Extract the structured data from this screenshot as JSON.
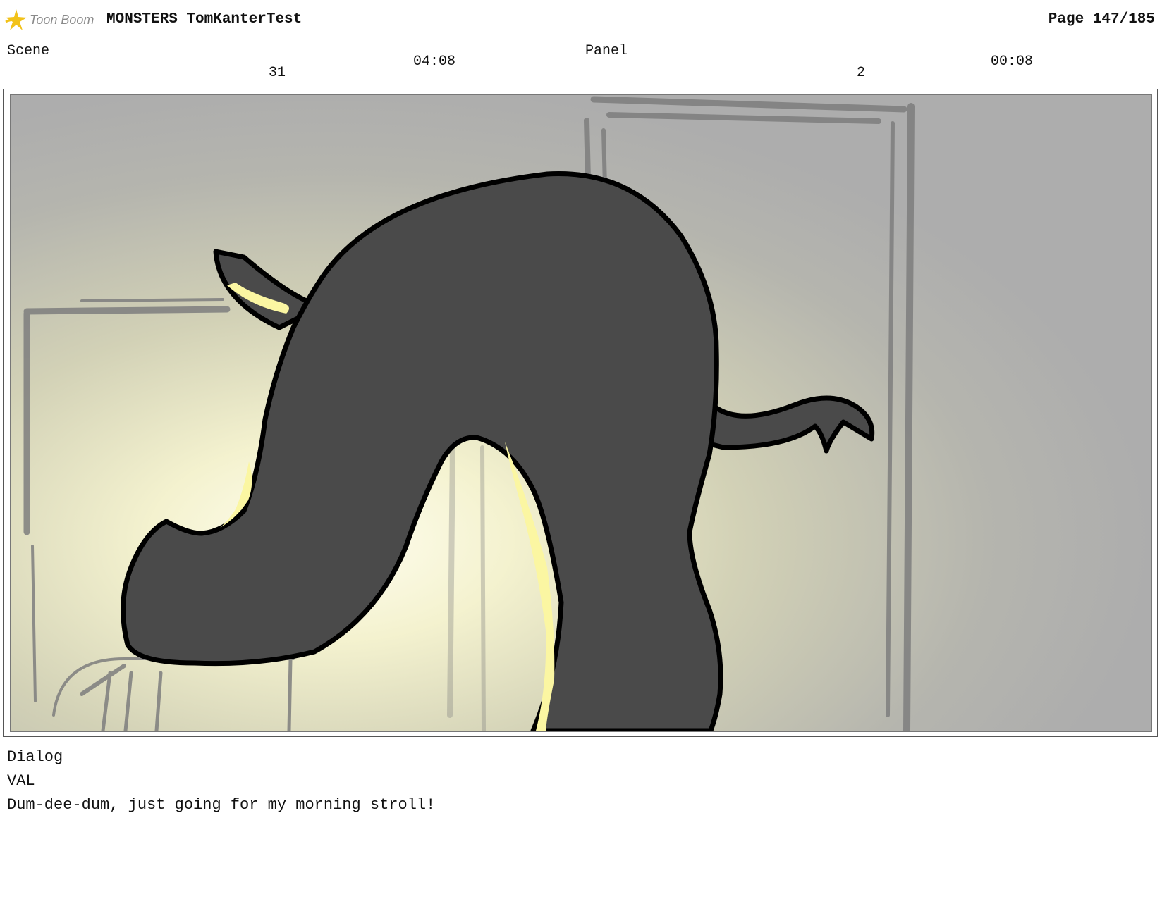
{
  "header": {
    "logo_text": "Toon Boom",
    "project_title": "MONSTERS TomKanterTest",
    "page_label": "Page 147/185"
  },
  "meta": {
    "scene_label": "Scene",
    "scene_number": "31",
    "scene_duration": "04:08",
    "panel_label": "Panel",
    "panel_number": "2",
    "panel_duration": "00:08"
  },
  "dialog": {
    "label": "Dialog",
    "character": "VAL",
    "line": "Dum-dee-dum, just going for my morning stroll!"
  },
  "colors": {
    "monster_fill": "#4a4a4a",
    "highlight": "#fbf6a2",
    "background_gray": "#afafaf",
    "glow": "#fffde8"
  }
}
